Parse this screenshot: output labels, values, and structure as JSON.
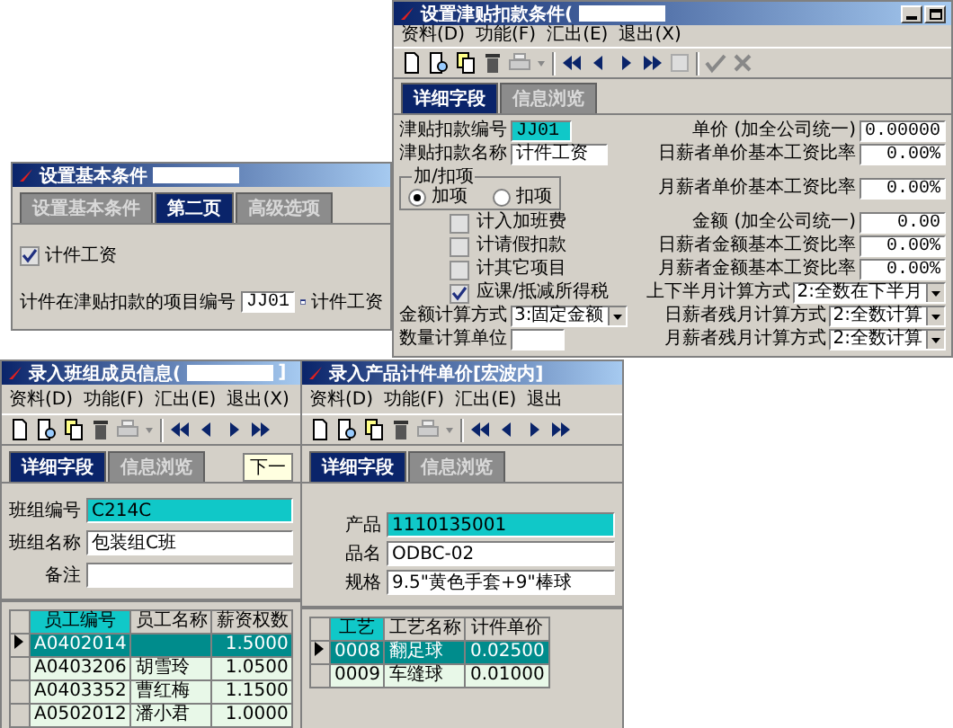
{
  "allowance_window": {
    "title": "设置津贴扣款条件(",
    "title_redacted": true,
    "menu": [
      "资料(D)",
      "功能(F)",
      "汇出(E)",
      "退出(X)"
    ],
    "tabs": [
      {
        "label": "详细字段",
        "selected": true
      },
      {
        "label": "信息浏览",
        "selected": false
      }
    ],
    "code": {
      "label": "津贴扣款编号",
      "value": "JJ01"
    },
    "name": {
      "label": "津贴扣款名称",
      "value": "计件工资"
    },
    "sign": {
      "label": "加/扣项",
      "options": [
        {
          "label": "加项",
          "selected": true
        },
        {
          "label": "扣项",
          "selected": false
        }
      ]
    },
    "checks": [
      {
        "label": "计入加班费",
        "checked": false
      },
      {
        "label": "计请假扣款",
        "checked": false
      },
      {
        "label": "计其它项目",
        "checked": false
      },
      {
        "label": "应课/抵减所得税",
        "checked": true
      }
    ],
    "amount_method": {
      "label": "金额计算方式",
      "value": "3:固定金额"
    },
    "quantity_unit": {
      "label": "数量计算单位"
    },
    "rates": [
      {
        "kind": "input",
        "label": "单价 (加全公司统一)",
        "value": "0.00000"
      },
      {
        "kind": "input",
        "label": "日薪者单价基本工资比率",
        "value": "0.00%"
      },
      {
        "kind": "input",
        "label": "月薪者单价基本工资比率",
        "value": "0.00%"
      },
      {
        "kind": "input",
        "label": "金额 (加全公司统一)",
        "value": "0.00"
      },
      {
        "kind": "input",
        "label": "日薪者金额基本工资比率",
        "value": "0.00%"
      },
      {
        "kind": "input",
        "label": "月薪者金额基本工资比率",
        "value": "0.00%"
      },
      {
        "kind": "select",
        "label": "上下半月计算方式",
        "value": "2:全数在下半月"
      },
      {
        "kind": "select",
        "label": "日薪者残月计算方式",
        "value": "2:全数计算"
      },
      {
        "kind": "select",
        "label": "月薪者残月计算方式",
        "value": "2:全数计算"
      }
    ]
  },
  "basic_window": {
    "title": "设置基本条件",
    "title_redacted": true,
    "tabs": [
      {
        "label": "设置基本条件",
        "selected": false
      },
      {
        "label": "第二页",
        "selected": true
      },
      {
        "label": "高级选项",
        "selected": false
      }
    ],
    "piecework": {
      "label": "计件工资",
      "checked": true
    },
    "item": {
      "label": "计件在津贴扣款的项目编号",
      "value": "JJ01",
      "name": "计件工资"
    }
  },
  "team_window": {
    "title": "录入班组成员信息(",
    "title_redacted": true,
    "title_end": "]",
    "menu": [
      "资料(D)",
      "功能(F)",
      "汇出(E)",
      "退出(X)"
    ],
    "tabs": [
      {
        "label": "详细字段",
        "selected": true
      },
      {
        "label": "信息浏览",
        "selected": false
      }
    ],
    "next_button": "下一",
    "fields": [
      {
        "label": "班组编号",
        "value": "C214C",
        "highlight": true
      },
      {
        "label": "班组名称",
        "value": "包装组C班",
        "highlight": false
      },
      {
        "label": "备注",
        "highlight": false
      }
    ],
    "table": {
      "columns": [
        {
          "label": "员工编号",
          "sorted": true
        },
        {
          "label": "员工名称",
          "sorted": false
        },
        {
          "label": "薪资权数",
          "sorted": false
        }
      ],
      "rows": [
        {
          "code": "A0402014",
          "weight": "1.5000",
          "selected": true
        },
        {
          "code": "A0403206",
          "name": "胡雪玲",
          "weight": "1.0500",
          "selected": false
        },
        {
          "code": "A0403352",
          "name": "曹红梅",
          "weight": "1.1500",
          "selected": false
        },
        {
          "code": "A0502012",
          "name": "潘小君",
          "weight": "1.0000",
          "selected": false
        }
      ]
    }
  },
  "product_window": {
    "title": "录入产品计件单价[宏波内]",
    "menu": [
      "资料(D)",
      "功能(F)",
      "汇出(E)",
      "退出"
    ],
    "tabs": [
      {
        "label": "详细字段",
        "selected": true
      },
      {
        "label": "信息浏览",
        "selected": false
      }
    ],
    "fields": [
      {
        "label": "产品",
        "value": "1110135001",
        "highlight": true
      },
      {
        "label": "品名",
        "value": "ODBC-02",
        "highlight": false
      },
      {
        "label": "规格",
        "value": "9.5\"黄色手套+9\"棒球",
        "highlight": false
      }
    ],
    "table": {
      "columns": [
        {
          "label": "工艺",
          "sorted": true
        },
        {
          "label": "工艺名称",
          "sorted": false
        },
        {
          "label": "计件单价",
          "sorted": false
        }
      ],
      "rows": [
        {
          "code": "0008",
          "name": "翻足球",
          "price": "0.02500",
          "selected": true
        },
        {
          "code": "0009",
          "name": "车缝球",
          "price": "0.01000",
          "selected": false
        }
      ]
    }
  }
}
